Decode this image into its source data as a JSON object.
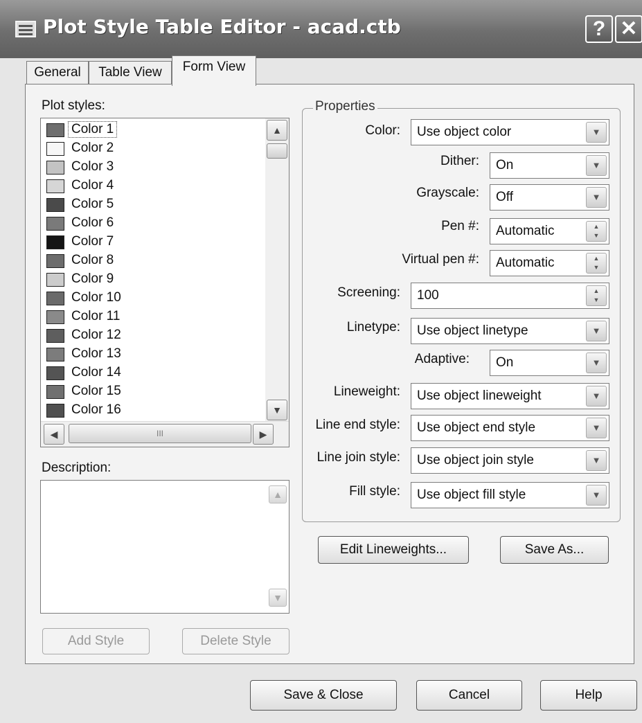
{
  "window": {
    "title": "Plot Style Table Editor - acad.ctb"
  },
  "titlebar": {
    "help_glyph": "?",
    "close_glyph": "✕"
  },
  "tabs": [
    {
      "label": "General"
    },
    {
      "label": "Table View"
    },
    {
      "label": "Form View",
      "active": true
    }
  ],
  "plot_styles": {
    "label": "Plot styles:",
    "selected": "Color 1",
    "items": [
      {
        "label": "Color 1",
        "swatch": "#6e6e6e"
      },
      {
        "label": "Color 2",
        "swatch": "#f7f7f7"
      },
      {
        "label": "Color 3",
        "swatch": "#c3c3c3"
      },
      {
        "label": "Color 4",
        "swatch": "#d6d6d6"
      },
      {
        "label": "Color 5",
        "swatch": "#4a4a4a"
      },
      {
        "label": "Color 6",
        "swatch": "#7a7a7a"
      },
      {
        "label": "Color 7",
        "swatch": "#151515"
      },
      {
        "label": "Color 8",
        "swatch": "#6c6c6c"
      },
      {
        "label": "Color 9",
        "swatch": "#cccccc"
      },
      {
        "label": "Color 10",
        "swatch": "#6a6a6a"
      },
      {
        "label": "Color 11",
        "swatch": "#8a8a8a"
      },
      {
        "label": "Color 12",
        "swatch": "#5e5e5e"
      },
      {
        "label": "Color 13",
        "swatch": "#7c7c7c"
      },
      {
        "label": "Color 14",
        "swatch": "#545454"
      },
      {
        "label": "Color 15",
        "swatch": "#707070"
      },
      {
        "label": "Color 16",
        "swatch": "#505050"
      }
    ],
    "hscroll_grip": "III"
  },
  "description": {
    "label": "Description:",
    "value": ""
  },
  "buttons": {
    "add_style": "Add Style",
    "delete_style": "Delete Style",
    "edit_lineweights": "Edit Lineweights...",
    "save_as": "Save As...",
    "save_close": "Save & Close",
    "cancel": "Cancel",
    "help": "Help"
  },
  "properties": {
    "group_label": "Properties",
    "color": {
      "label": "Color:",
      "value": "Use object color"
    },
    "dither": {
      "label": "Dither:",
      "value": "On"
    },
    "grayscale": {
      "label": "Grayscale:",
      "value": "Off"
    },
    "pen": {
      "label": "Pen #:",
      "value": "Automatic"
    },
    "virtual_pen": {
      "label": "Virtual pen #:",
      "value": "Automatic"
    },
    "screening": {
      "label": "Screening:",
      "value": "100"
    },
    "linetype": {
      "label": "Linetype:",
      "value": "Use object linetype"
    },
    "adaptive": {
      "label": "Adaptive:",
      "value": "On"
    },
    "lineweight": {
      "label": "Lineweight:",
      "value": "Use object lineweight"
    },
    "line_end_style": {
      "label": "Line end style:",
      "value": "Use object end style"
    },
    "line_join_style": {
      "label": "Line join style:",
      "value": "Use object join style"
    },
    "fill_style": {
      "label": "Fill style:",
      "value": "Use object fill style"
    }
  }
}
